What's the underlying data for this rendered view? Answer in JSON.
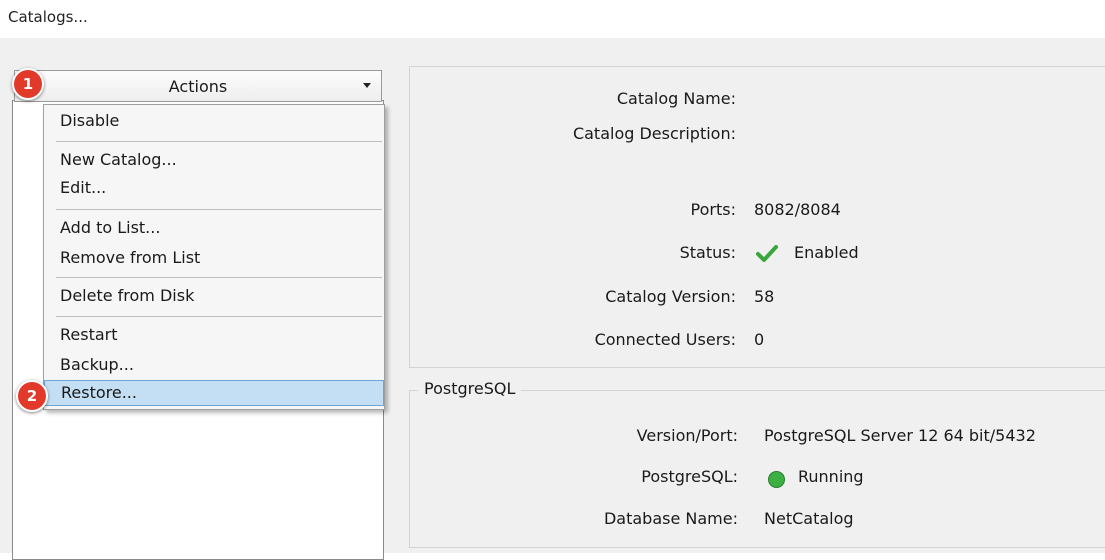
{
  "window": {
    "title": "Catalogs..."
  },
  "actions": {
    "label": "Actions",
    "menu": {
      "disable": "Disable",
      "new_catalog": "New Catalog...",
      "edit": "Edit...",
      "add_to_list": "Add to List...",
      "remove_from_list": "Remove from List",
      "delete_from_disk": "Delete from Disk",
      "restart": "Restart",
      "backup": "Backup...",
      "restore": "Restore..."
    },
    "highlighted_item": "Restore..."
  },
  "badges": {
    "step1": "1",
    "step2": "2"
  },
  "catalog": {
    "name_label": "Catalog Name:",
    "name_value": "",
    "description_label": "Catalog Description:",
    "description_value": "",
    "ports_label": "Ports:",
    "ports_value": "8082/8084",
    "status_label": "Status:",
    "status_value": "Enabled",
    "status_icon": "checkmark-icon",
    "version_label": "Catalog Version:",
    "version_value": "58",
    "users_label": "Connected Users:",
    "users_value": "0"
  },
  "postgres": {
    "group_title": "PostgreSQL",
    "version_label": "Version/Port:",
    "version_value": "PostgreSQL Server 12 64 bit/5432",
    "status_label": "PostgreSQL:",
    "status_value": "Running",
    "status_icon": "green-dot-icon",
    "db_label": "Database Name:",
    "db_value": "NetCatalog"
  },
  "colors": {
    "badge": "#e23a2a",
    "highlight": "#c4def3",
    "check": "#3aa53a",
    "running_dot": "#3cb043"
  }
}
